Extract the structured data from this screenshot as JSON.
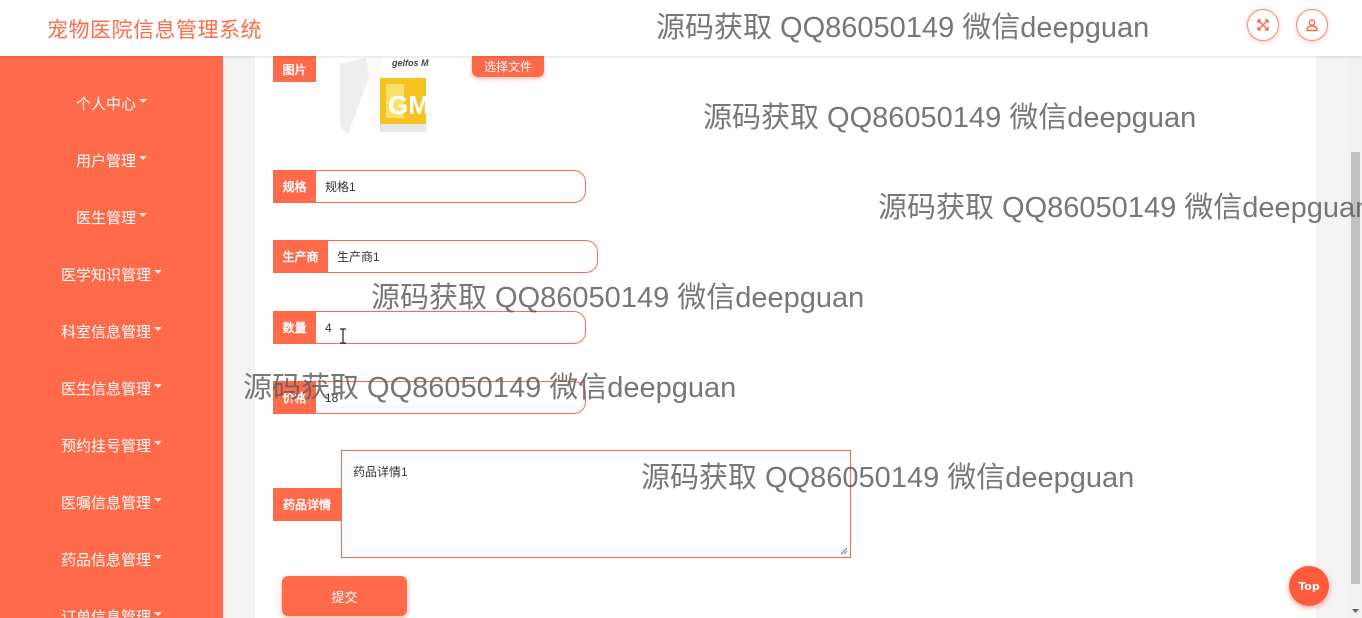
{
  "header": {
    "title": "宠物医院信息管理系统",
    "fullscreen_icon": "expand-icon",
    "user_icon": "user-icon"
  },
  "sidebar": {
    "items": [
      {
        "label": "个人中心"
      },
      {
        "label": "用户管理"
      },
      {
        "label": "医生管理"
      },
      {
        "label": "医学知识管理"
      },
      {
        "label": "科室信息管理"
      },
      {
        "label": "医生信息管理"
      },
      {
        "label": "预约挂号管理"
      },
      {
        "label": "医嘱信息管理"
      },
      {
        "label": "药品信息管理"
      },
      {
        "label": "订单信息管理"
      }
    ]
  },
  "form": {
    "image": {
      "label": "图片",
      "file_button": "选择文件"
    },
    "spec": {
      "label": "规格",
      "value": "规格1"
    },
    "manufacturer": {
      "label": "生产商",
      "value": "生产商1"
    },
    "quantity": {
      "label": "数量",
      "value": "4"
    },
    "price": {
      "label": "价格",
      "value": "18"
    },
    "details": {
      "label": "药品详情",
      "value": "药品详情1"
    },
    "submit": "提交"
  },
  "watermark": "源码获取 QQ86050149 微信deepguan",
  "top_button": "Top",
  "colors": {
    "accent": "#ff6b4a",
    "panel": "#ffffff",
    "background": "#f3f3f3"
  }
}
